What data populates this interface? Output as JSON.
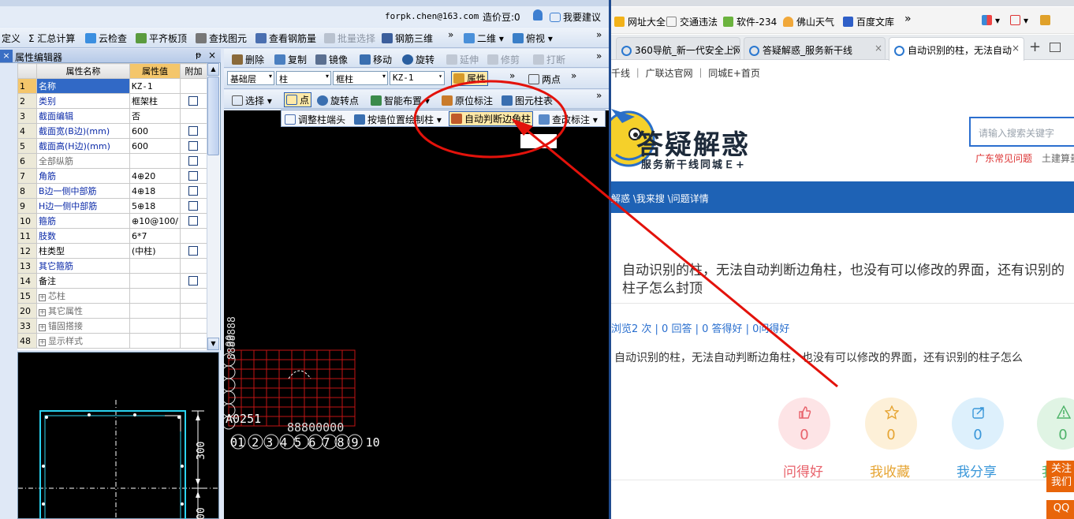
{
  "app": {
    "account": "forpk.chen@163.com",
    "points_label": "造价豆:0",
    "suggest_label": "我要建议",
    "toolbar1": [
      {
        "label": "定义"
      },
      {
        "label": "Σ 汇总计算"
      },
      {
        "label": "云检查"
      },
      {
        "label": "平齐板顶"
      },
      {
        "label": "查找图元"
      },
      {
        "label": "查看钢筋量"
      },
      {
        "label": "批量选择"
      },
      {
        "label": "钢筋三维"
      },
      {
        "label": "二维"
      },
      {
        "label": "俯视"
      }
    ],
    "overflow": "»",
    "property_editor": {
      "title": "属性编辑器",
      "pin": "ᵽ",
      "close": "×",
      "headers": [
        "属性名称",
        "属性值",
        "附加"
      ],
      "rows": [
        {
          "num": "1",
          "name": "名称",
          "value": "KZ-1",
          "check": false,
          "style": "blue",
          "selected": true
        },
        {
          "num": "2",
          "name": "类别",
          "value": "框架柱",
          "check": true,
          "style": "blue"
        },
        {
          "num": "3",
          "name": "截面编辑",
          "value": "否",
          "check": false,
          "style": "blue"
        },
        {
          "num": "4",
          "name": "截面宽(B边)(mm)",
          "value": "600",
          "check": true,
          "style": "blue"
        },
        {
          "num": "5",
          "name": "截面高(H边)(mm)",
          "value": "600",
          "check": true,
          "style": "blue"
        },
        {
          "num": "6",
          "name": "全部纵筋",
          "value": "",
          "check": true,
          "style": "gray"
        },
        {
          "num": "7",
          "name": "角筋",
          "value": "4⊕20",
          "check": true,
          "style": "blue"
        },
        {
          "num": "8",
          "name": "B边一侧中部筋",
          "value": "4⊕18",
          "check": true,
          "style": "blue"
        },
        {
          "num": "9",
          "name": "H边一侧中部筋",
          "value": "5⊕18",
          "check": true,
          "style": "blue"
        },
        {
          "num": "10",
          "name": "箍筋",
          "value": "⊕10@100/",
          "check": true,
          "style": "blue"
        },
        {
          "num": "11",
          "name": "肢数",
          "value": "6*7",
          "check": false,
          "style": "blue"
        },
        {
          "num": "12",
          "name": "柱类型",
          "value": "(中柱)",
          "check": true,
          "style": "normal"
        },
        {
          "num": "13",
          "name": "其它箍筋",
          "value": "",
          "check": false,
          "style": "blue"
        },
        {
          "num": "14",
          "name": "备注",
          "value": "",
          "check": true,
          "style": "normal"
        },
        {
          "num": "15",
          "name": "芯柱",
          "value": "",
          "check": false,
          "style": "gray",
          "expand": true
        },
        {
          "num": "20",
          "name": "其它属性",
          "value": "",
          "check": false,
          "style": "gray",
          "expand": true
        },
        {
          "num": "33",
          "name": "锚固搭接",
          "value": "",
          "check": false,
          "style": "gray",
          "expand": true
        },
        {
          "num": "48",
          "name": "显示样式",
          "value": "",
          "check": false,
          "style": "gray",
          "expand": true
        }
      ]
    },
    "edit_toolbar": [
      "删除",
      "复制",
      "镜像",
      "移动",
      "旋转",
      "延伸",
      "修剪",
      "打断"
    ],
    "layer_toolbar": {
      "layer": "基础层",
      "element": "柱",
      "type": "框柱",
      "name": "KZ-1",
      "attr_button": "属性",
      "two_point": "两点"
    },
    "draw_toolbar": [
      "选择",
      "点",
      "旋转点",
      "智能布置",
      "原位标注",
      "图元柱表"
    ],
    "popup_toolbar": [
      "调整柱端头",
      "按墙位置绘制柱",
      "自动判断边角柱",
      "查改标注"
    ],
    "preview": {
      "dim1": "300",
      "dim2": "00"
    },
    "canvas": {
      "label": "A0251",
      "axis_numbers": "01 2 3 4 5 6 7 8 9 10",
      "axis_left": "00",
      "axis_extra": "88800000",
      "axis_extra2": "8888888"
    }
  },
  "browser": {
    "bookmarks": [
      {
        "label": "网址大全"
      },
      {
        "label": "交通违法"
      },
      {
        "label": "软件-234"
      },
      {
        "label": "佛山天气"
      },
      {
        "label": "百度文库"
      },
      {
        "label": "»"
      }
    ],
    "tabs": [
      {
        "label": "360导航_新一代安全上网",
        "close": "×",
        "active": false
      },
      {
        "label": "答疑解惑_服务新干线",
        "close": "×",
        "active": false
      },
      {
        "label": "自动识别的柱，无法自动",
        "close": "×",
        "active": true
      }
    ],
    "tab_plus": "+",
    "sublinks": "千线 ｜ 广联达官网 ｜ 同城E+首页",
    "logo_title": "答疑解惑",
    "logo_sub": "服务新干线同城Ｅ+",
    "search_placeholder": "请输入搜索关键字",
    "hotlinks": [
      "广东常见问题",
      "土建算量"
    ],
    "breadcrumb": "解惑 \\我来搜 \\问题详情",
    "question_title": "自动识别的柱，无法自动判断边角柱，也没有可以修改的界面，还有识别的柱子怎么封顶",
    "stats": "浏览2 次 | 0 回答 | 0 答得好 | 0问得好",
    "question_body": "自动识别的柱，无法自动判断边角柱，也没有可以修改的界面，还有识别的柱子怎么",
    "actions": [
      {
        "label": "问得好",
        "count": "0",
        "color": "#e8626b",
        "bg": "#fde4e6"
      },
      {
        "label": "我收藏",
        "count": "0",
        "color": "#e6a534",
        "bg": "#fdf0d8"
      },
      {
        "label": "我分享",
        "count": "0",
        "color": "#3a97d9",
        "bg": "#ddf0fc"
      },
      {
        "label": "我",
        "count": "0",
        "color": "#4fb36a",
        "bg": "#e0f4e4"
      }
    ],
    "side_follow": "关注我们",
    "side_qq": "QQ"
  },
  "colors": {
    "annotation": "#e3120b",
    "selected_header": "#f4c66b",
    "selection": "#3169c6",
    "navbar": "#1e62b5",
    "cad_grid": "#c21414"
  }
}
